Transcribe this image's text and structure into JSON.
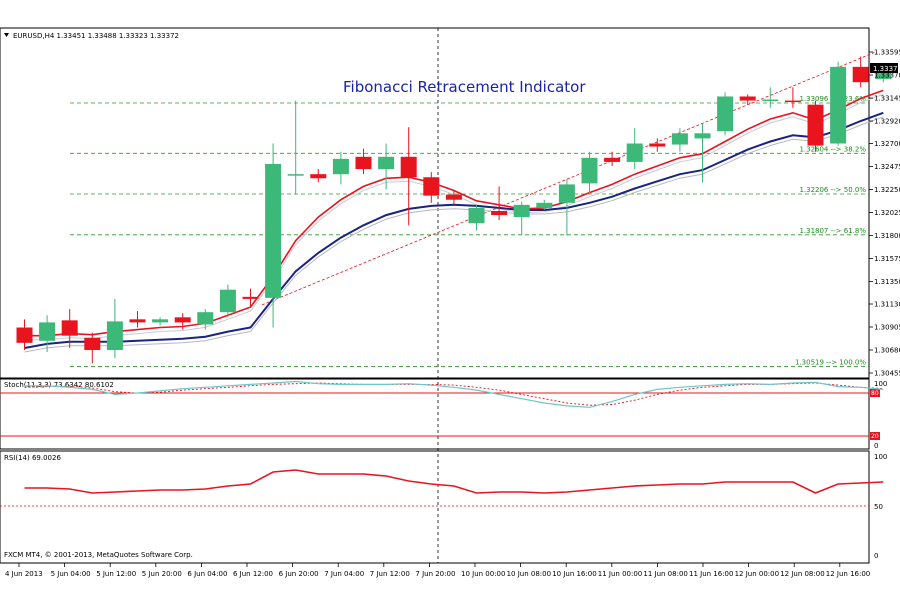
{
  "header": {
    "symbol_line": "EURUSD,H4  1.33451 1.33488 1.33323 1.33372",
    "chart_title": "Fibonacci Retracement Indicator"
  },
  "price_axis": {
    "ticks": [
      "1.33595",
      "1.33370",
      "1.33145",
      "1.32920",
      "1.32700",
      "1.32475",
      "1.32250",
      "1.32025",
      "1.31800",
      "1.31575",
      "1.31350",
      "1.31130",
      "1.30905",
      "1.30680",
      "1.30455"
    ],
    "current_price": "1.33372"
  },
  "fibonacci": {
    "levels": [
      {
        "price": 1.33096,
        "label": "1.33096 --> 23.6%"
      },
      {
        "price": 1.32604,
        "label": "1.32604 --> 38.2%"
      },
      {
        "price": 1.32206,
        "label": "1.32206 --> 50.0%"
      },
      {
        "price": 1.31807,
        "label": "1.31807 --> 61.8%"
      },
      {
        "price": 1.30519,
        "label": "1.30519 --> 100.0%"
      }
    ]
  },
  "stochastic": {
    "label": "Stoch(11,3,3) 73.6342 80.6102",
    "axis_ticks": [
      "100",
      "0"
    ],
    "level_tags": [
      "80",
      "20"
    ]
  },
  "rsi": {
    "label": "RSI(14) 69.0026",
    "axis_ticks": [
      "100",
      "50",
      "0"
    ]
  },
  "copyright": "FXCM MT4, © 2001-2013, MetaQuotes Software Corp.",
  "time_axis": [
    "4 Jun 2013",
    "5 Jun 04:00",
    "5 Jun 12:00",
    "5 Jun 20:00",
    "6 Jun 04:00",
    "6 Jun 12:00",
    "6 Jun 20:00",
    "7 Jun 04:00",
    "7 Jun 12:00",
    "7 Jun 20:00",
    "10 Jun 00:00",
    "10 Jun 08:00",
    "10 Jun 16:00",
    "11 Jun 00:00",
    "11 Jun 08:00",
    "11 Jun 16:00",
    "12 Jun 00:00",
    "12 Jun 08:00",
    "12 Jun 16:00"
  ],
  "colors": {
    "bull": "#3cb878",
    "bear": "#e8141e",
    "fib": "#2e9e2e",
    "ma_fast": "#e8141e",
    "ma_slow": "#1a2380",
    "stoch_main": "#6fc6c6",
    "stoch_signal": "#e8141e",
    "rsi": "#e8141e",
    "title": "#1a24a8"
  },
  "chart_data": {
    "type": "candlestick",
    "candles": [
      {
        "o": 1.309,
        "h": 1.3098,
        "c": 1.3075,
        "l": 1.3068
      },
      {
        "o": 1.3077,
        "h": 1.3102,
        "c": 1.3095,
        "l": 1.3066
      },
      {
        "o": 1.3097,
        "h": 1.3108,
        "c": 1.3082,
        "l": 1.307
      },
      {
        "o": 1.308,
        "h": 1.3085,
        "c": 1.3068,
        "l": 1.3055
      },
      {
        "o": 1.3068,
        "h": 1.3118,
        "c": 1.3096,
        "l": 1.306
      },
      {
        "o": 1.3098,
        "h": 1.3106,
        "c": 1.3095,
        "l": 1.309
      },
      {
        "o": 1.3095,
        "h": 1.31,
        "c": 1.3098,
        "l": 1.3092
      },
      {
        "o": 1.31,
        "h": 1.3104,
        "c": 1.3095,
        "l": 1.3088
      },
      {
        "o": 1.3093,
        "h": 1.3108,
        "c": 1.3105,
        "l": 1.3088
      },
      {
        "o": 1.3105,
        "h": 1.3132,
        "c": 1.3127,
        "l": 1.31
      },
      {
        "o": 1.312,
        "h": 1.3128,
        "c": 1.3118,
        "l": 1.311
      },
      {
        "o": 1.3119,
        "h": 1.327,
        "c": 1.325,
        "l": 1.309
      },
      {
        "o": 1.324,
        "h": 1.3312,
        "c": 1.324,
        "l": 1.322
      },
      {
        "o": 1.324,
        "h": 1.3245,
        "c": 1.3236,
        "l": 1.3232
      },
      {
        "o": 1.324,
        "h": 1.3262,
        "c": 1.3255,
        "l": 1.323
      },
      {
        "o": 1.3257,
        "h": 1.3265,
        "c": 1.3245,
        "l": 1.324
      },
      {
        "o": 1.3245,
        "h": 1.327,
        "c": 1.3257,
        "l": 1.3225
      },
      {
        "o": 1.3257,
        "h": 1.3286,
        "c": 1.3237,
        "l": 1.319
      },
      {
        "o": 1.3237,
        "h": 1.3242,
        "c": 1.3219,
        "l": 1.3212
      },
      {
        "o": 1.322,
        "h": 1.3225,
        "c": 1.3215,
        "l": 1.321
      },
      {
        "o": 1.3192,
        "h": 1.321,
        "c": 1.3207,
        "l": 1.3185
      },
      {
        "o": 1.3204,
        "h": 1.3228,
        "c": 1.32,
        "l": 1.3195
      },
      {
        "o": 1.3198,
        "h": 1.3213,
        "c": 1.321,
        "l": 1.318
      },
      {
        "o": 1.3207,
        "h": 1.3215,
        "c": 1.3212,
        "l": 1.3205
      },
      {
        "o": 1.3212,
        "h": 1.3235,
        "c": 1.323,
        "l": 1.318
      },
      {
        "o": 1.3231,
        "h": 1.3262,
        "c": 1.3256,
        "l": 1.322
      },
      {
        "o": 1.3256,
        "h": 1.3262,
        "c": 1.3252,
        "l": 1.3248
      },
      {
        "o": 1.3252,
        "h": 1.3285,
        "c": 1.327,
        "l": 1.3245
      },
      {
        "o": 1.327,
        "h": 1.3275,
        "c": 1.3267,
        "l": 1.3262
      },
      {
        "o": 1.3269,
        "h": 1.3285,
        "c": 1.328,
        "l": 1.3262
      },
      {
        "o": 1.3275,
        "h": 1.329,
        "c": 1.328,
        "l": 1.3232
      },
      {
        "o": 1.3282,
        "h": 1.332,
        "c": 1.3316,
        "l": 1.3278
      },
      {
        "o": 1.3316,
        "h": 1.3318,
        "c": 1.3312,
        "l": 1.3308
      },
      {
        "o": 1.3313,
        "h": 1.3325,
        "c": 1.3313,
        "l": 1.3305
      },
      {
        "o": 1.3312,
        "h": 1.3325,
        "c": 1.3311,
        "l": 1.3305
      },
      {
        "o": 1.3308,
        "h": 1.3312,
        "c": 1.3268,
        "l": 1.3262
      },
      {
        "o": 1.327,
        "h": 1.335,
        "c": 1.3345,
        "l": 1.3268
      },
      {
        "o": 1.3345,
        "h": 1.3355,
        "c": 1.333,
        "l": 1.3325
      },
      {
        "o": 1.3333,
        "h": 1.3349,
        "c": 1.3343,
        "l": 1.333
      }
    ],
    "ma_fast": [
      1.3082,
      1.3082,
      1.3084,
      1.3083,
      1.3086,
      1.3088,
      1.309,
      1.3091,
      1.3094,
      1.3102,
      1.311,
      1.314,
      1.3175,
      1.3198,
      1.3215,
      1.3228,
      1.3236,
      1.3237,
      1.3232,
      1.3224,
      1.3214,
      1.321,
      1.3206,
      1.3207,
      1.3213,
      1.3222,
      1.323,
      1.324,
      1.3248,
      1.3256,
      1.326,
      1.3272,
      1.3284,
      1.3294,
      1.33,
      1.3293,
      1.3303,
      1.3314,
      1.3322
    ],
    "ma_slow": [
      1.307,
      1.3074,
      1.3076,
      1.3076,
      1.3076,
      1.3077,
      1.3078,
      1.3079,
      1.3081,
      1.3086,
      1.309,
      1.3118,
      1.3145,
      1.3163,
      1.3178,
      1.319,
      1.32,
      1.3206,
      1.3209,
      1.321,
      1.3209,
      1.3207,
      1.3205,
      1.3205,
      1.3207,
      1.3212,
      1.3218,
      1.3226,
      1.3233,
      1.324,
      1.3244,
      1.3254,
      1.3264,
      1.3272,
      1.3278,
      1.3276,
      1.3283,
      1.3292,
      1.33
    ],
    "trendline": {
      "from": {
        "index": 10.5,
        "price": 1.3112
      },
      "to": {
        "index": 37.6,
        "price": 1.3359
      }
    },
    "stoch_main": [
      90,
      90,
      88,
      85,
      78,
      80,
      83,
      86,
      88,
      90,
      92,
      94,
      96,
      93,
      92,
      92,
      92,
      93,
      91,
      88,
      84,
      78,
      72,
      66,
      62,
      60,
      68,
      78,
      85,
      88,
      90,
      92,
      93,
      92,
      94,
      95,
      89,
      88,
      85
    ],
    "stoch_signal": [
      88,
      89,
      90,
      87,
      82,
      80,
      81,
      84,
      86,
      88,
      90,
      92,
      93,
      94,
      93,
      92,
      92,
      92,
      92,
      91,
      88,
      84,
      78,
      72,
      66,
      63,
      64,
      70,
      78,
      84,
      88,
      90,
      92,
      92,
      93,
      94,
      91,
      88,
      86
    ],
    "rsi": [
      68,
      68,
      67,
      63,
      64,
      65,
      66,
      66,
      67,
      70,
      72,
      84,
      86,
      82,
      82,
      82,
      80,
      75,
      72,
      70,
      63,
      64,
      64,
      63,
      64,
      66,
      68,
      70,
      71,
      72,
      72,
      74,
      74,
      74,
      74,
      63,
      72,
      73,
      74
    ]
  }
}
